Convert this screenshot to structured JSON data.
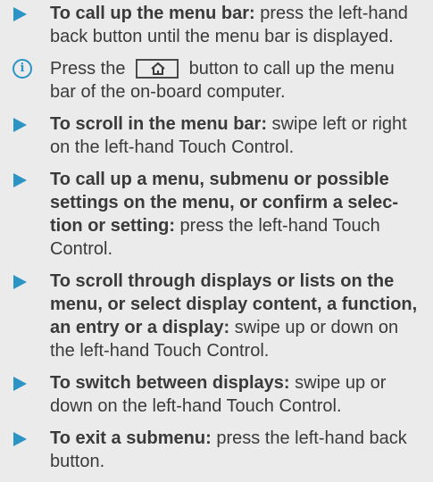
{
  "items": [
    {
      "bold": "To call up the menu bar:",
      "text": " press the left-hand back button until the menu bar is displayed."
    },
    {
      "before": "Press the",
      "after": "button to call up the menu bar of the on-board computer."
    },
    {
      "bold": "To scroll in the menu bar:",
      "text": " swipe left or right on the left-hand Touch Control."
    },
    {
      "bold": "To call up a menu, submenu or possible settings on the menu, or confirm a selec­tion or setting:",
      "text": " press the left-hand Touch Control."
    },
    {
      "bold": "To scroll through displays or lists on the menu, or select display content, a func­tion, an entry or a display:",
      "text": " swipe up or down on the left-hand Touch Control."
    },
    {
      "bold": "To switch between displays:",
      "text": " swipe up or down on the left-hand Touch Control."
    },
    {
      "bold": "To exit a submenu:",
      "text": " press the left-hand back button."
    }
  ],
  "icons": {
    "bullet": "arrow-bullet-icon",
    "info": "info-icon",
    "home": "home-icon",
    "info_glyph": "i"
  },
  "colors": {
    "accent": "#2b94c5",
    "background": "#ebebeb",
    "text": "#3a3a3a"
  }
}
